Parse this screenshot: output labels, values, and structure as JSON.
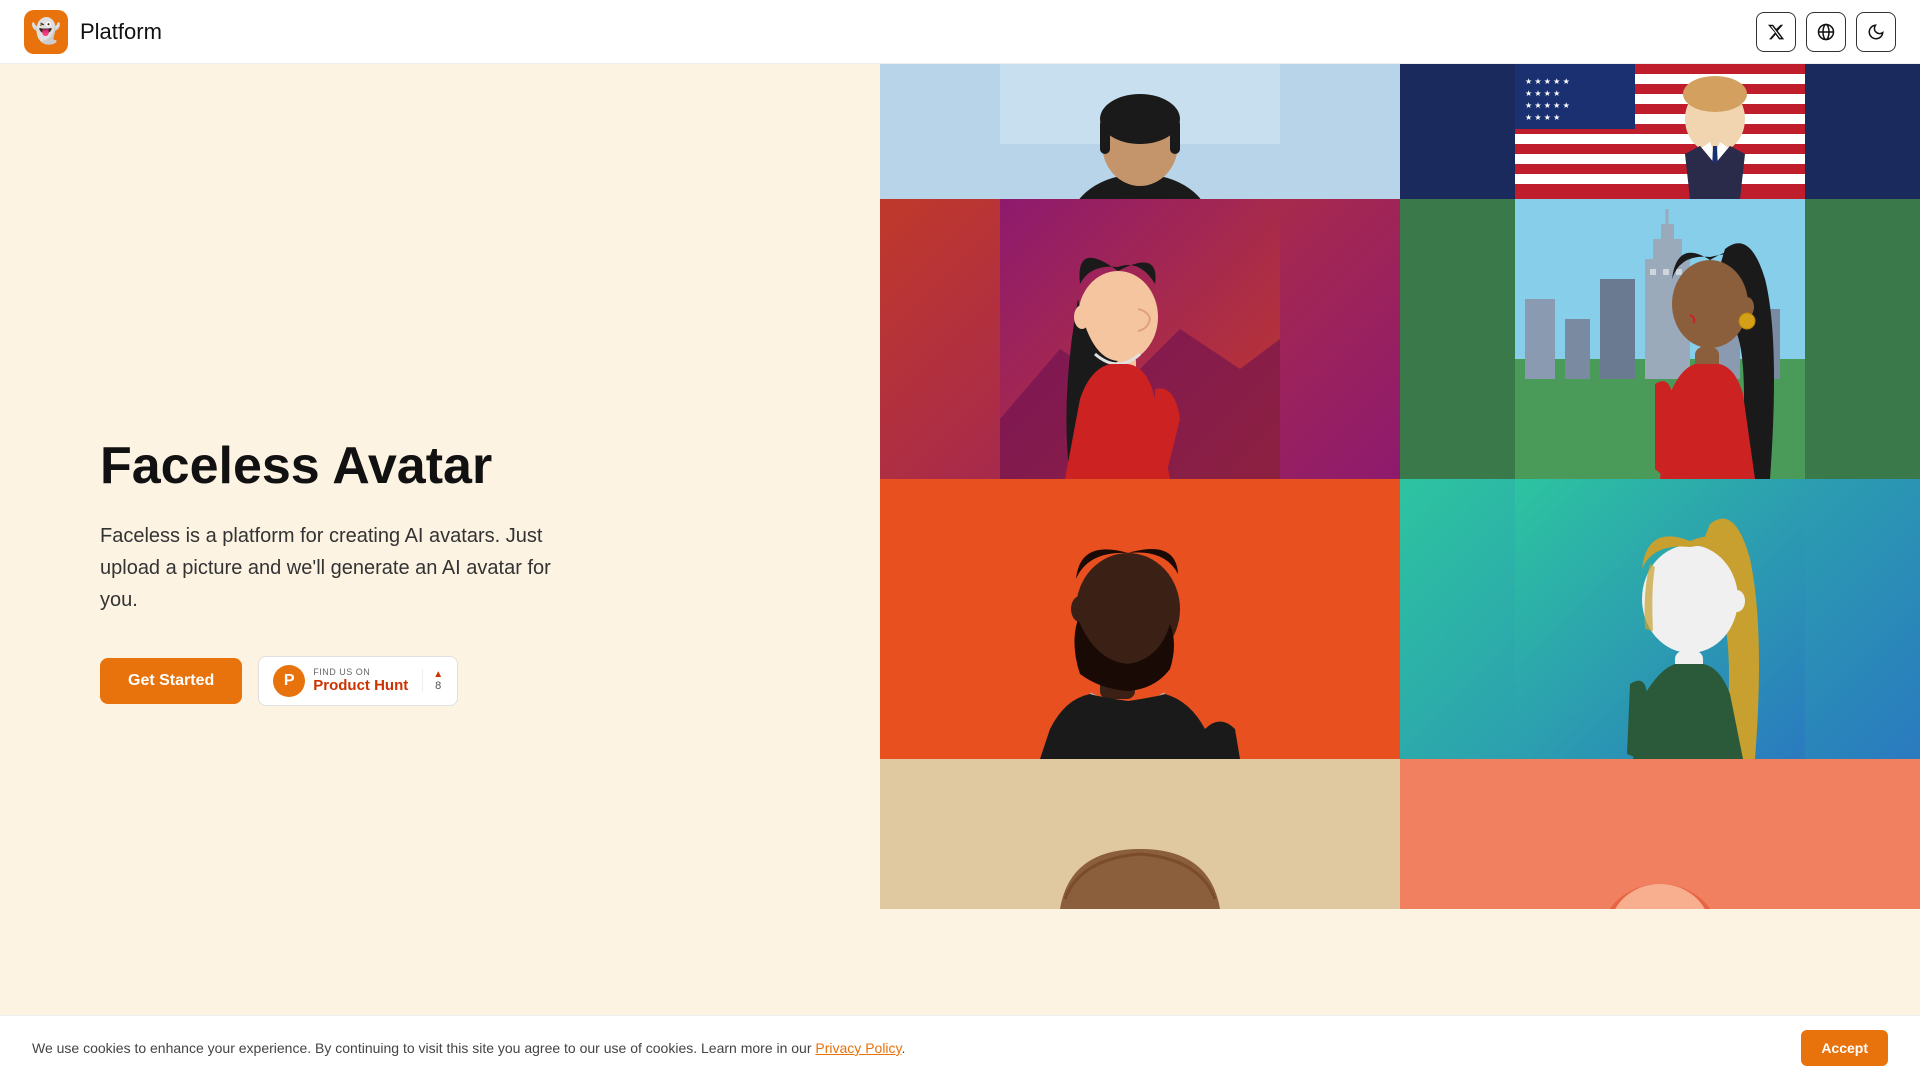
{
  "navbar": {
    "logo_emoji": "👻",
    "title": "Platform",
    "twitter_label": "X",
    "globe_label": "🌐",
    "dark_mode_label": "🌙"
  },
  "hero": {
    "title": "Faceless Avatar",
    "description": "Faceless is a platform for creating AI avatars. Just upload a picture and we'll generate an AI avatar for you.",
    "cta_label": "Get Started",
    "product_hunt": {
      "find_label": "FIND US ON",
      "name": "Product Hunt",
      "count": "8",
      "arrow": "▲"
    }
  },
  "cookie": {
    "message": "We use cookies to enhance your experience. By continuing to visit this site you agree to our use of cookies. Learn more in our",
    "link_text": "Privacy Policy",
    "accept_label": "Accept"
  },
  "avatars": [
    {
      "id": 1,
      "bg": "dark-jacket-person"
    },
    {
      "id": 2,
      "bg": "suit-person"
    },
    {
      "id": 3,
      "bg": "red-dress-woman"
    },
    {
      "id": 4,
      "bg": "red-dress-woman-city"
    },
    {
      "id": 5,
      "bg": "bearded-man"
    },
    {
      "id": 6,
      "bg": "blonde-woman"
    },
    {
      "id": 7,
      "bg": "partial-head"
    },
    {
      "id": 8,
      "bg": "orange-bg"
    }
  ]
}
